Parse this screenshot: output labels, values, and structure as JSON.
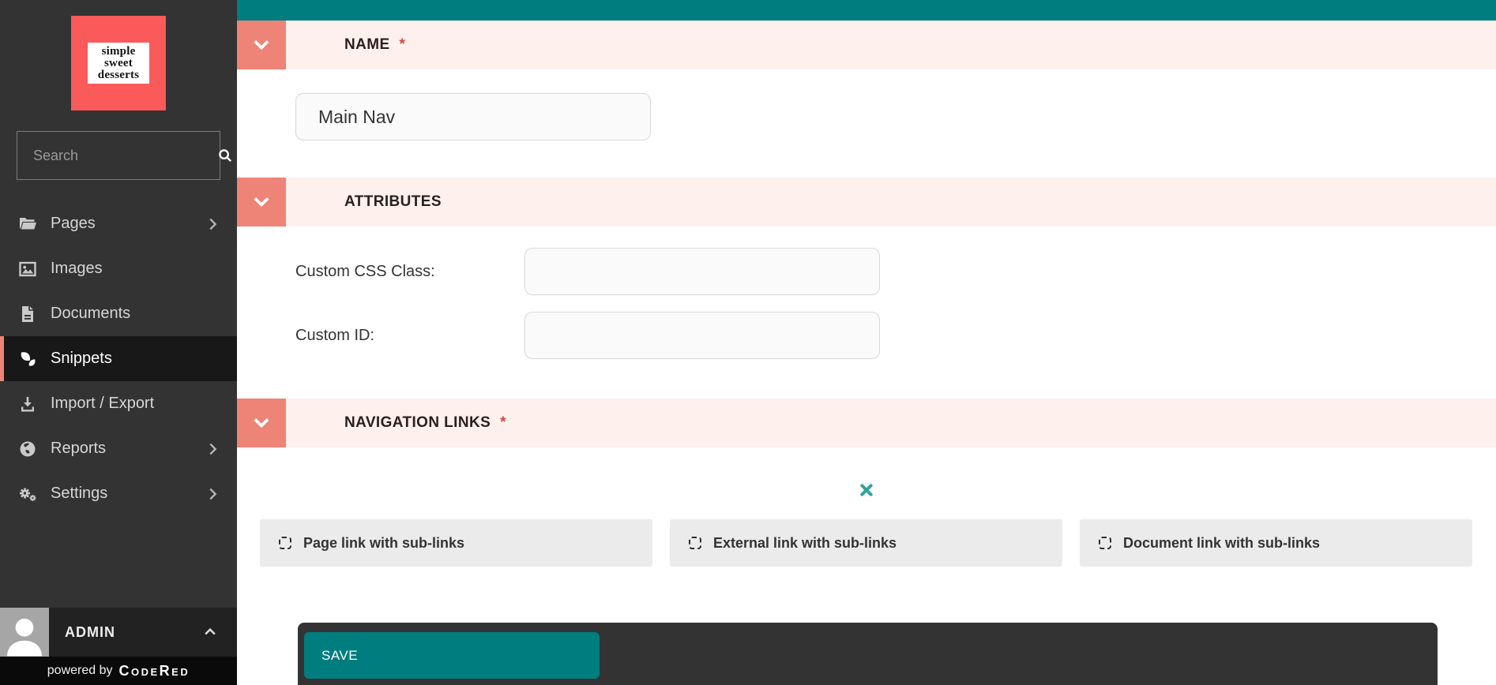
{
  "colors": {
    "sidebar_bg": "#333333",
    "sidebar_active_bg": "#181818",
    "accent_coral": "#ee8377",
    "logo_red": "#fa5a5a",
    "teal": "#007d7e",
    "teal_delete_icon": "#31a1a1",
    "section_header_pink": "#fdf0ed",
    "required_red": "#d14949",
    "add_button_gray": "#ebebeb",
    "bottom_bar_dark": "#333333",
    "powered_bar_black": "#0a0a0a"
  },
  "sidebar": {
    "logo_lines": [
      "simple",
      "sweet",
      "desserts"
    ],
    "search": {
      "placeholder": "Search"
    },
    "items": [
      {
        "label": "Pages",
        "icon": "folder-open-icon",
        "has_submenu": true,
        "active": false
      },
      {
        "label": "Images",
        "icon": "image-icon",
        "has_submenu": false,
        "active": false
      },
      {
        "label": "Documents",
        "icon": "document-icon",
        "has_submenu": false,
        "active": false
      },
      {
        "label": "Snippets",
        "icon": "snippets-leaf-icon",
        "has_submenu": false,
        "active": true
      },
      {
        "label": "Import / Export",
        "icon": "download-icon",
        "has_submenu": false,
        "active": false
      },
      {
        "label": "Reports",
        "icon": "globe-icon",
        "has_submenu": true,
        "active": false
      },
      {
        "label": "Settings",
        "icon": "gears-icon",
        "has_submenu": true,
        "active": false
      }
    ],
    "account": {
      "label": "ADMIN"
    },
    "powered_by": {
      "prefix": "powered by",
      "brand": "CodeRed"
    }
  },
  "main": {
    "required_marker": "*",
    "sections": [
      {
        "title": "NAME",
        "required": true
      },
      {
        "title": "ATTRIBUTES",
        "required": false
      },
      {
        "title": "NAVIGATION LINKS",
        "required": true
      }
    ],
    "name_field": {
      "value": "Main Nav"
    },
    "attributes": {
      "fields": [
        {
          "label": "Custom CSS Class:",
          "value": ""
        },
        {
          "label": "Custom ID:",
          "value": ""
        }
      ]
    },
    "navigation_links": {
      "add_buttons": [
        {
          "label": "Page link with sub-links"
        },
        {
          "label": "External link with sub-links"
        },
        {
          "label": "Document link with sub-links"
        }
      ]
    },
    "footer": {
      "save_label": "SAVE"
    }
  }
}
